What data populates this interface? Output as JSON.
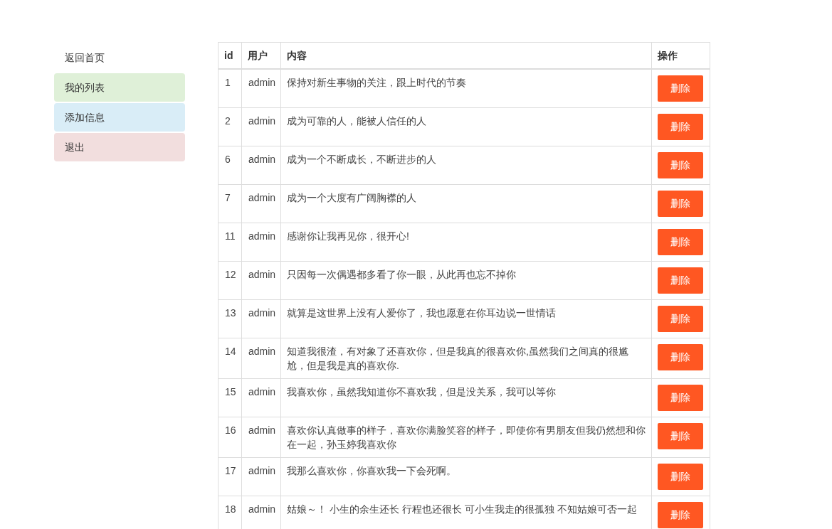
{
  "sidebar": {
    "items": [
      {
        "label": "返回首页"
      },
      {
        "label": "我的列表",
        "color": "#dff0d8"
      },
      {
        "label": "添加信息",
        "color": "#d9edf7"
      },
      {
        "label": "退出",
        "color": "#f2dede"
      }
    ]
  },
  "table": {
    "columns": [
      "id",
      "用户",
      "内容",
      "操作"
    ],
    "rows": [
      {
        "id": "1",
        "user": "admin",
        "content": "保持对新生事物的关注，跟上时代的节奏",
        "action": "删除"
      },
      {
        "id": "2",
        "user": "admin",
        "content": "成为可靠的人，能被人信任的人",
        "action": "删除"
      },
      {
        "id": "6",
        "user": "admin",
        "content": "成为一个不断成长，不断进步的人",
        "action": "删除"
      },
      {
        "id": "7",
        "user": "admin",
        "content": "成为一个大度有广阔胸襟的人",
        "action": "删除"
      },
      {
        "id": "11",
        "user": "admin",
        "content": "感谢你让我再见你，很开心!",
        "action": "删除"
      },
      {
        "id": "12",
        "user": "admin",
        "content": "只因每一次偶遇都多看了你一眼，从此再也忘不掉你",
        "action": "删除"
      },
      {
        "id": "13",
        "user": "admin",
        "content": "就算是这世界上没有人爱你了，我也愿意在你耳边说一世情话",
        "action": "删除"
      },
      {
        "id": "14",
        "user": "admin",
        "content": "知道我很渣，有对象了还喜欢你，但是我真的很喜欢你,虽然我们之间真的很尴尬，但是我是真的喜欢你.",
        "action": "删除"
      },
      {
        "id": "15",
        "user": "admin",
        "content": "我喜欢你，虽然我知道你不喜欢我，但是没关系，我可以等你",
        "action": "删除"
      },
      {
        "id": "16",
        "user": "admin",
        "content": "喜欢你认真做事的样子，喜欢你满脸笑容的样子，即使你有男朋友但我仍然想和你在一起，孙玉婷我喜欢你",
        "action": "删除"
      },
      {
        "id": "17",
        "user": "admin",
        "content": "我那么喜欢你，你喜欢我一下会死啊。",
        "action": "删除"
      },
      {
        "id": "18",
        "user": "admin",
        "content": "姑娘～！  小生的余生还长 行程也还很长 可小生我走的很孤独 不知姑娘可否一起",
        "action": "删除"
      }
    ]
  }
}
